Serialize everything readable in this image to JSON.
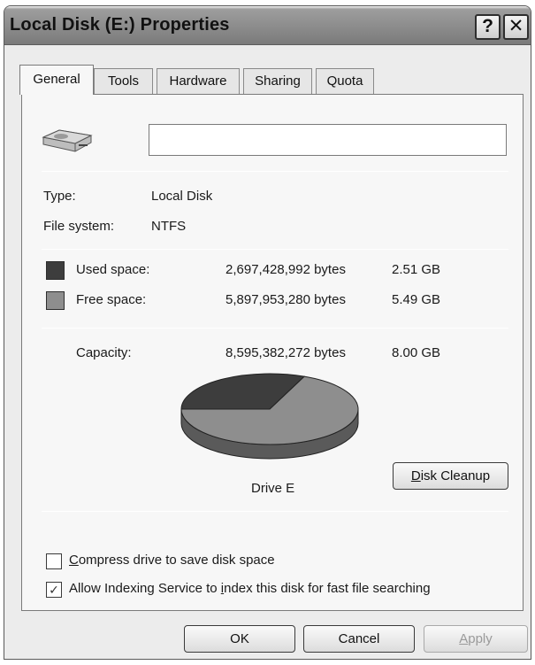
{
  "window": {
    "title": "Local Disk (E:) Properties"
  },
  "titlebar_buttons": {
    "help": "?",
    "close": "✕"
  },
  "tabs": [
    {
      "label": "General",
      "active": true
    },
    {
      "label": "Tools"
    },
    {
      "label": "Hardware"
    },
    {
      "label": "Sharing"
    },
    {
      "label": "Quota"
    }
  ],
  "general": {
    "name_value": "",
    "type_label": "Type:",
    "type_value": "Local Disk",
    "fs_label": "File system:",
    "fs_value": "NTFS",
    "used": {
      "label": "Used space:",
      "bytes": "2,697,428,992 bytes",
      "size": "2.51 GB"
    },
    "free": {
      "label": "Free space:",
      "bytes": "5,897,953,280 bytes",
      "size": "5.49 GB"
    },
    "capacity": {
      "label": "Capacity:",
      "bytes": "8,595,382,272 bytes",
      "size": "8.00 GB"
    },
    "drive_label": "Drive E",
    "disk_cleanup": {
      "pre": "",
      "accel": "D",
      "post": "isk Cleanup"
    },
    "compress": {
      "accel": "C",
      "post": "ompress drive to save disk space",
      "checked": false
    },
    "index": {
      "pre": "Allow Indexing Service to ",
      "accel": "i",
      "post": "ndex this disk for fast file searching",
      "checked": true
    },
    "chart_fractions": {
      "used": 0.3138,
      "free": 0.6862
    }
  },
  "footer": {
    "ok": "OK",
    "cancel": "Cancel",
    "apply": {
      "accel": "A",
      "post": "pply"
    }
  },
  "colors": {
    "used": "#3d3d3d",
    "free": "#8e8e8e",
    "panel": "#f7f7f7"
  },
  "icons": {
    "drive": "hard-drive-icon",
    "check": "checkmark-icon"
  }
}
